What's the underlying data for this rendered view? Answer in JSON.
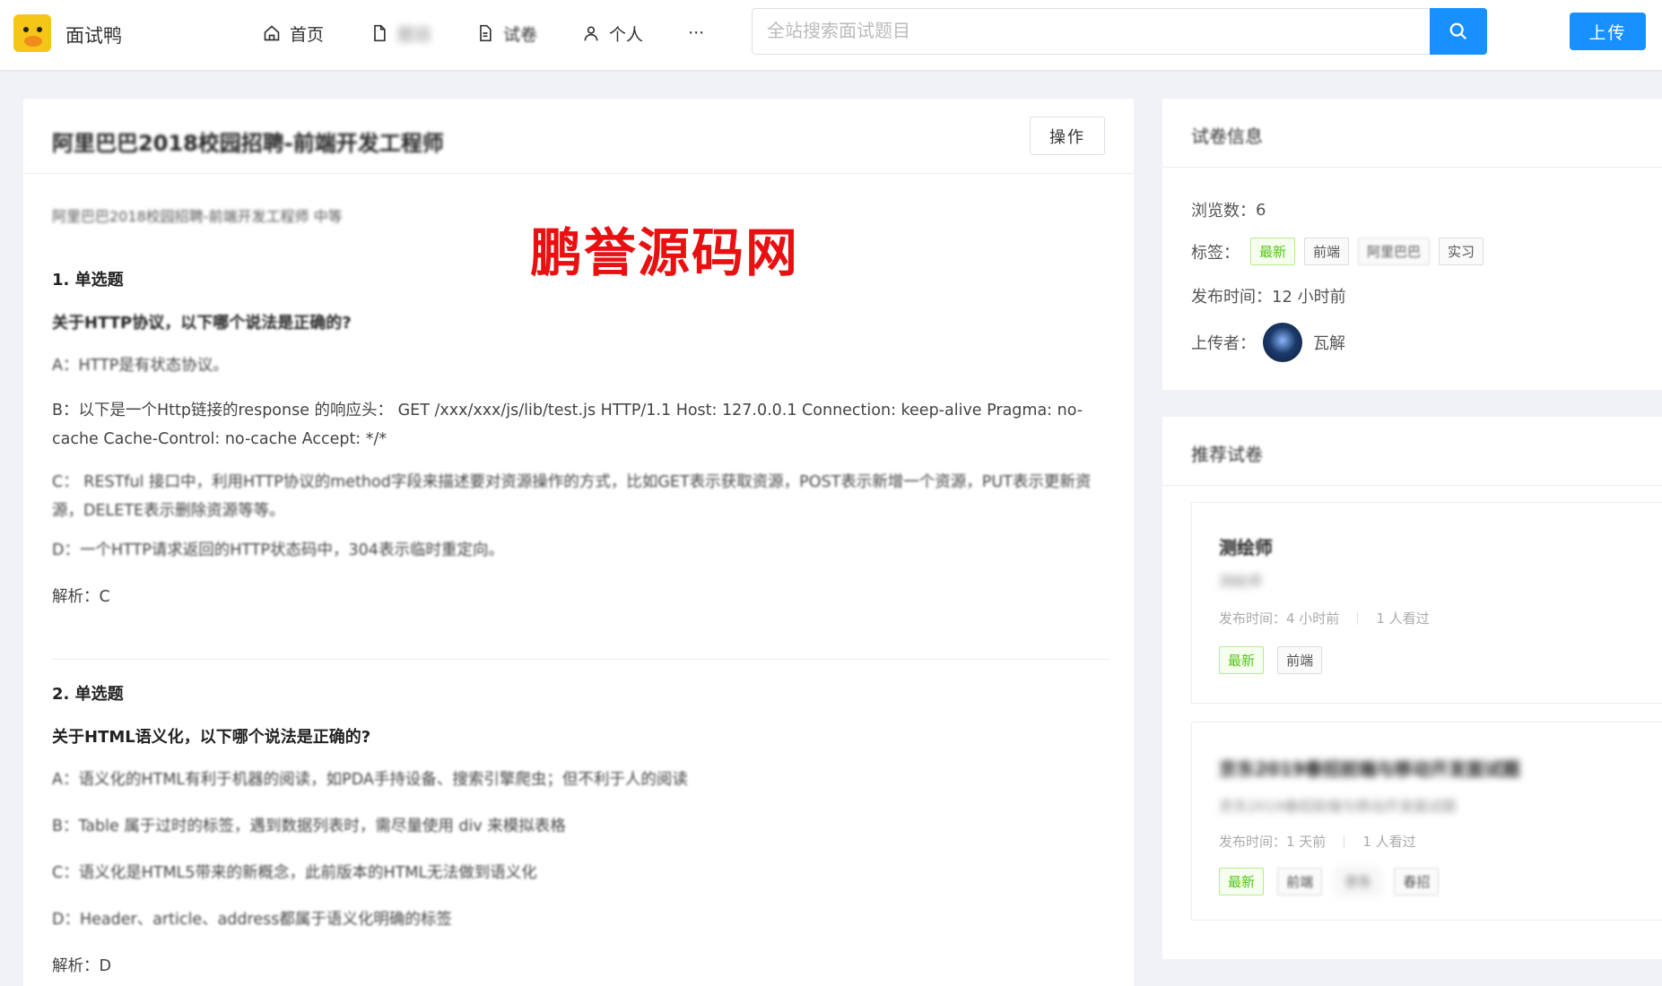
{
  "header": {
    "site_name": "面试鸭",
    "nav": [
      {
        "label": "首页",
        "icon": "home-icon"
      },
      {
        "label": "题目",
        "icon": "document-icon"
      },
      {
        "label": "试卷",
        "icon": "file-text-icon"
      },
      {
        "label": "个人",
        "icon": "user-icon"
      },
      {
        "label": "···",
        "icon": "more-icon"
      }
    ],
    "search_placeholder": "全站搜索面试题目",
    "upload_label": "上传",
    "accent_color": "#1890ff"
  },
  "question": {
    "title": "阿里巴巴2018校园招聘-前端开发工程师",
    "operate_label": "操作",
    "subtitle": "阿里巴巴2018校园招聘-前端开发工程师 中等",
    "watermark": "鹏誉源码网",
    "items": [
      {
        "num": "1. 单选题",
        "question": "关于HTTP协议，以下哪个说法是正确的?",
        "options": [
          "A：HTTP是有状态协议。",
          "B：以下是一个Http链接的response 的响应头： GET /xxx/xxx/js/lib/test.js HTTP/1.1 Host: 127.0.0.1 Connection: keep-alive Pragma: no-cache Cache-Control: no-cache Accept: */*",
          "C： RESTful 接口中，利用HTTP协议的method字段来描述要对资源操作的方式，比如GET表示获取资源，POST表示新增一个资源，PUT表示更新资源，DELETE表示删除资源等等。",
          "D：一个HTTP请求返回的HTTP状态码中，304表示临时重定向。"
        ],
        "analysis": "解析：C"
      },
      {
        "num": "2. 单选题",
        "question": "关于HTML语义化，以下哪个说法是正确的?",
        "options": [
          "A：语义化的HTML有利于机器的阅读，如PDA手持设备、搜索引擎爬虫；但不利于人的阅读",
          "B：Table 属于过时的标签，遇到数据列表时，需尽量使用 div 来模拟表格",
          "C：语义化是HTML5带来的新概念，此前版本的HTML无法做到语义化",
          "D：Header、article、address都属于语义化明确的标签"
        ],
        "analysis": "解析：D"
      }
    ]
  },
  "sidebar": {
    "info_title": "试卷信息",
    "views_label": "浏览数：",
    "views": "6",
    "tags_label": "标签：",
    "tags": [
      {
        "text": "最新",
        "style": "green"
      },
      {
        "text": "前端",
        "style": "plain"
      },
      {
        "text": "阿里巴巴",
        "style": "plain"
      },
      {
        "text": "实习",
        "style": "plain"
      }
    ],
    "publish_label": "发布时间：",
    "publish_time": "12 小时前",
    "uploader_label": "上传者：",
    "uploader": "瓦解",
    "recommend_title": "推荐试卷",
    "recommendations": [
      {
        "title": "测绘师",
        "desc": "测绘师",
        "time_label": "发布时间：4 小时前",
        "views_label": "1 人看过",
        "tags": [
          {
            "text": "最新",
            "style": "green"
          },
          {
            "text": "前端",
            "style": "plain"
          }
        ]
      },
      {
        "title": "京东2019春招前端与移动开发面试题",
        "desc": "京东2019春招前端与移动开发面试题",
        "time_label": "发布时间：1 天前",
        "views_label": "1 人看过",
        "tags": [
          {
            "text": "最新",
            "style": "green"
          },
          {
            "text": "前端",
            "style": "plain"
          },
          {
            "text": "京东",
            "style": "plain"
          },
          {
            "text": "春招",
            "style": "plain"
          }
        ]
      }
    ]
  }
}
